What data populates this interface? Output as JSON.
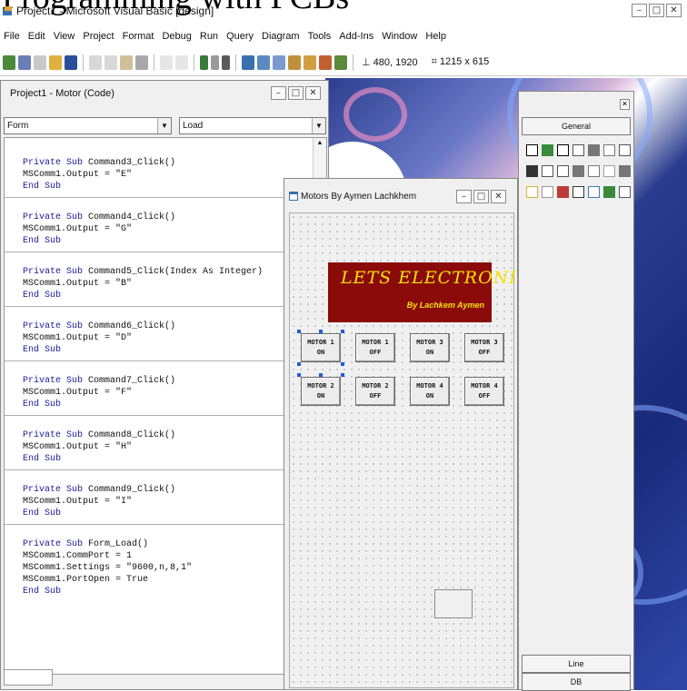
{
  "banner": {
    "text": "Programming with PCBs"
  },
  "window": {
    "title": "Project1 - Microsoft Visual Basic [design]"
  },
  "menu": [
    "File",
    "Edit",
    "View",
    "Project",
    "Format",
    "Debug",
    "Run",
    "Query",
    "Diagram",
    "Tools",
    "Add-Ins",
    "Window",
    "Help"
  ],
  "toolbar": {
    "position": "480, 1920",
    "size": "1215 x 615"
  },
  "code_window": {
    "title": "Project1 - Motor (Code)",
    "object_combo": "Form",
    "proc_combo": "Load",
    "blocks": [
      {
        "sub": "Command3_Click()",
        "body": [
          "MSComm1.Output = \"E\""
        ]
      },
      {
        "sub": "Command4_Click()",
        "body": [
          "MSComm1.Output = \"G\""
        ]
      },
      {
        "sub": "Command5_Click(Index As Integer)",
        "body": [
          "MSComm1.Output = \"B\""
        ]
      },
      {
        "sub": "Command6_Click()",
        "body": [
          "MSComm1.Output = \"D\""
        ]
      },
      {
        "sub": "Command7_Click()",
        "body": [
          "MSComm1.Output = \"F\""
        ]
      },
      {
        "sub": "Command8_Click()",
        "body": [
          "MSComm1.Output = \"H\""
        ]
      },
      {
        "sub": "Command9_Click()",
        "body": [
          "MSComm1.Output = \"I\""
        ]
      },
      {
        "sub": "Form_Load()",
        "body": [
          "MSComm1.CommPort = 1",
          "MSComm1.Settings = \"9600,n,8,1\"",
          "MSComm1.PortOpen = True"
        ]
      }
    ],
    "kw_private": "Private Sub",
    "kw_end": "End Sub"
  },
  "form_window": {
    "title": "Motors By Aymen Lachkhem",
    "logo_line1": "LETS ELECTRONIC",
    "logo_line2": "By Lachkem Aymen",
    "buttons": [
      [
        "MOTOR 1",
        "ON"
      ],
      [
        "MOTOR 1",
        "OFF"
      ],
      [
        "MOTOR 3",
        "ON"
      ],
      [
        "MOTOR 3",
        "OFF"
      ],
      [
        "MOTOR 2",
        "ON"
      ],
      [
        "MOTOR 2",
        "OFF"
      ],
      [
        "MOTOR 4",
        "ON"
      ],
      [
        "MOTOR 4",
        "OFF"
      ]
    ]
  },
  "toolbox": {
    "tab_general": "General",
    "tab_line": "Line",
    "tab_db": "DB"
  },
  "colors": {
    "logo_bg": "#8b0b0b",
    "logo_text": "#f4e200",
    "keyword": "#1a1a9a",
    "selection_handle": "#1b5fd9"
  }
}
